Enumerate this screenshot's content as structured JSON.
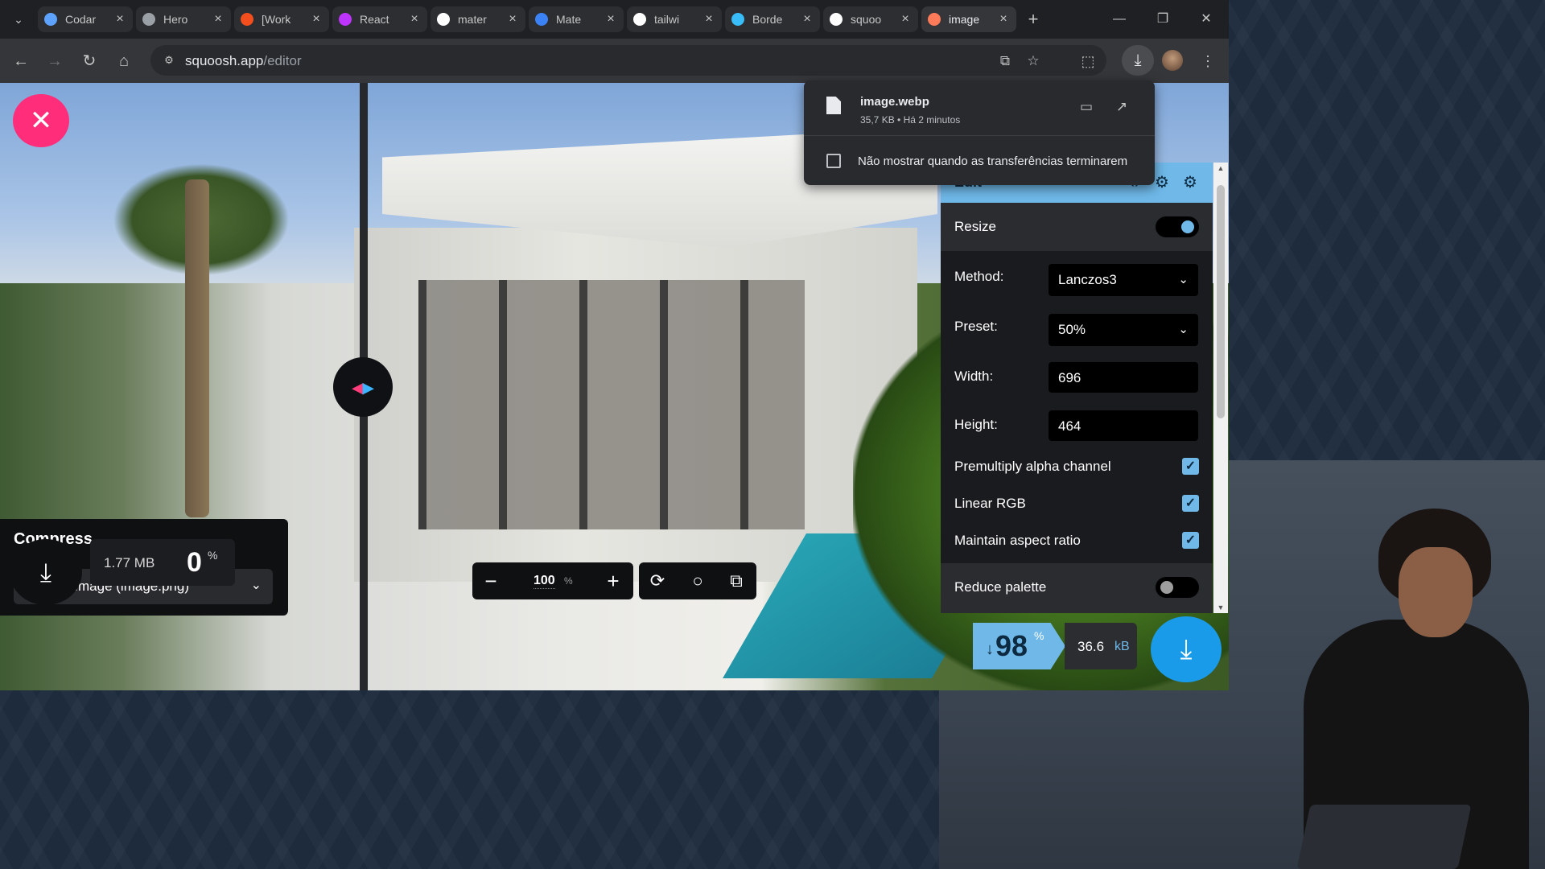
{
  "browser": {
    "tabs": [
      {
        "title": "Codar",
        "favicon": "code-favicon",
        "color": "#5ea2ff",
        "active": false
      },
      {
        "title": "Hero",
        "favicon": "globe-favicon",
        "color": "#9aa0a6",
        "active": false
      },
      {
        "title": "[Work",
        "favicon": "figma-favicon",
        "color": "#f24e1e",
        "active": false
      },
      {
        "title": "React",
        "favicon": "vite-favicon",
        "color": "#bd34fe",
        "active": false
      },
      {
        "title": "mater",
        "favicon": "google-favicon",
        "color": "#ffffff",
        "active": false
      },
      {
        "title": "Mate",
        "favicon": "mui-favicon",
        "color": "#3b82f6",
        "active": false
      },
      {
        "title": "tailwi",
        "favicon": "google-favicon",
        "color": "#ffffff",
        "active": false
      },
      {
        "title": "Borde",
        "favicon": "tailwind-favicon",
        "color": "#38bdf8",
        "active": false
      },
      {
        "title": "squoo",
        "favicon": "google-favicon",
        "color": "#ffffff",
        "active": false
      },
      {
        "title": "image",
        "favicon": "squoosh-favicon",
        "color": "#ff7a59",
        "active": true
      }
    ],
    "url_host": "squoosh.app",
    "url_path": "/editor"
  },
  "downloads": {
    "filename": "image.webp",
    "meta": "35,7 KB • Há 2 minutos",
    "checkbox_label": "Não mostrar quando as transferências terminarem"
  },
  "compress": {
    "title": "Compress",
    "select_value": "Original Image (image.png)",
    "size": "1.77 MB",
    "percent": "0",
    "percent_sign": "%"
  },
  "zoom": {
    "value": "100",
    "unit": "%"
  },
  "edit": {
    "title": "Edit",
    "resize_label": "Resize",
    "resize_on": true,
    "method_label": "Method:",
    "method_value": "Lanczos3",
    "preset_label": "Preset:",
    "preset_value": "50%",
    "width_label": "Width:",
    "width_value": "696",
    "height_label": "Height:",
    "height_value": "464",
    "premultiply_label": "Premultiply alpha channel",
    "linear_rgb_label": "Linear RGB",
    "aspect_label": "Maintain aspect ratio",
    "reduce_palette_label": "Reduce palette",
    "reduce_palette_on": false
  },
  "result": {
    "arrow": "↓",
    "percent": "98",
    "percent_sign": "%",
    "size": "36.6",
    "unit": "kB"
  },
  "colors": {
    "accent_blue": "#6fb8e8",
    "accent_pink": "#ff2d7a",
    "download_blue": "#1a9bea"
  }
}
